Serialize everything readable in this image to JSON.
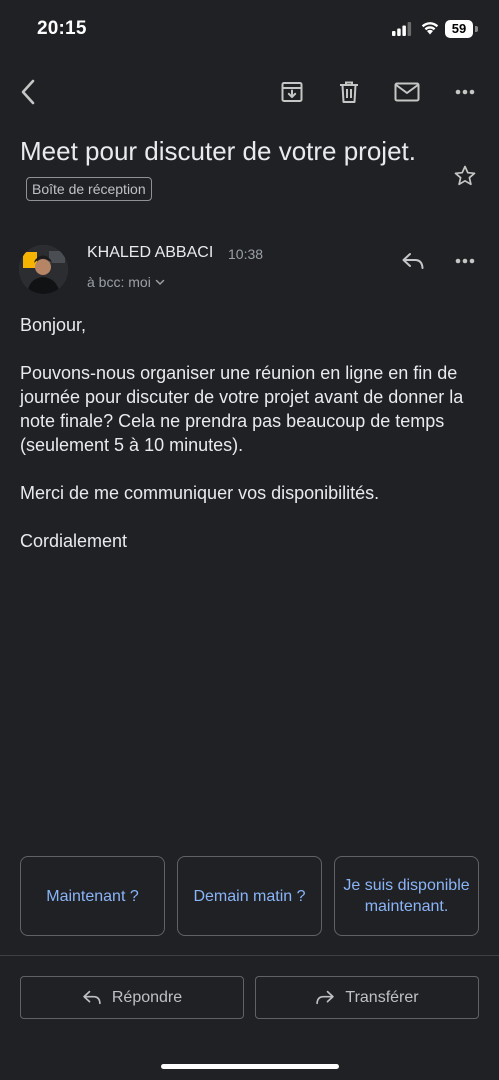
{
  "status_bar": {
    "time": "20:15",
    "battery": "59",
    "icons": [
      "signal-icon",
      "wifi-icon",
      "battery-icon"
    ]
  },
  "toolbar": {
    "icons": [
      "back-icon",
      "archive-icon",
      "delete-icon",
      "mark-unread-icon",
      "more-icon"
    ]
  },
  "email": {
    "subject": "Meet pour discuter de votre projet.",
    "label": "Boîte de réception",
    "sender_name": "KHALED ABBACI",
    "time": "10:38",
    "recipient": "à bcc: moi",
    "body": [
      "Bonjour,",
      "Pouvons-nous organiser une réunion en ligne en fin de journée pour discuter de votre projet avant de donner la note finale? Cela ne prendra pas beaucoup de temps (seulement 5 à 10 minutes).",
      "Merci de me communiquer vos disponibilités.",
      "Cordialement"
    ]
  },
  "smart_replies": [
    "Maintenant ?",
    "Demain matin ?",
    "Je suis disponible maintenant."
  ],
  "actions": {
    "reply": "Répondre",
    "forward": "Transférer"
  },
  "colors": {
    "background": "#202124",
    "accent": "#8ab4f8",
    "text": "#e8eaed",
    "muted": "#9aa0a6"
  }
}
